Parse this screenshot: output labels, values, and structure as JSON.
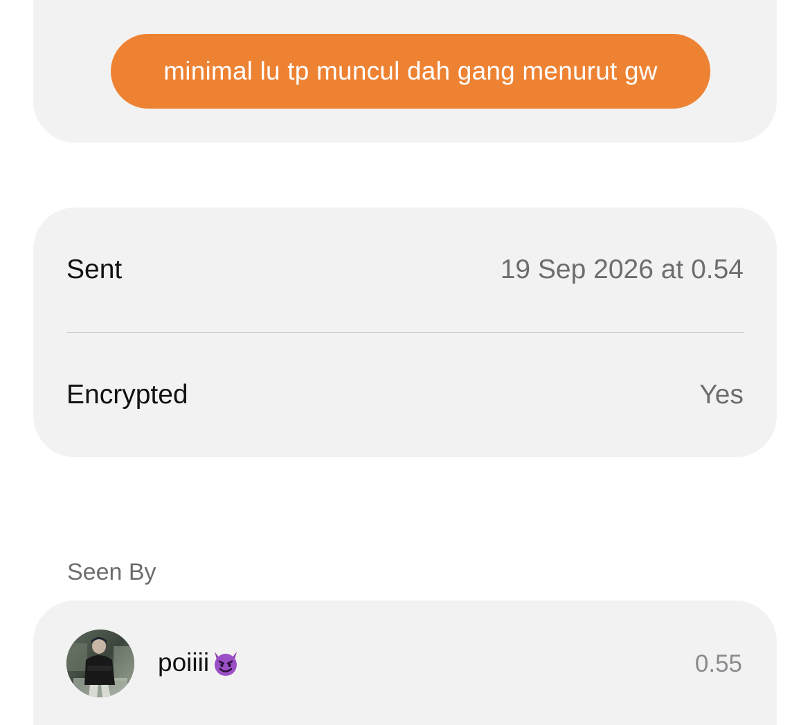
{
  "message": {
    "text": "minimal lu tp muncul dah gang menurut gw",
    "bubble_color": "#ee8233"
  },
  "info": {
    "sent_label": "Sent",
    "sent_value": "19 Sep 2026 at 0.54",
    "encrypted_label": "Encrypted",
    "encrypted_value": "Yes"
  },
  "seen_by": {
    "header": "Seen By",
    "viewers": [
      {
        "name": "poiiii",
        "emoji_icon": "smiling-devil-icon",
        "time": "0.55",
        "avatar_icon": "user-photo-avatar"
      }
    ]
  }
}
